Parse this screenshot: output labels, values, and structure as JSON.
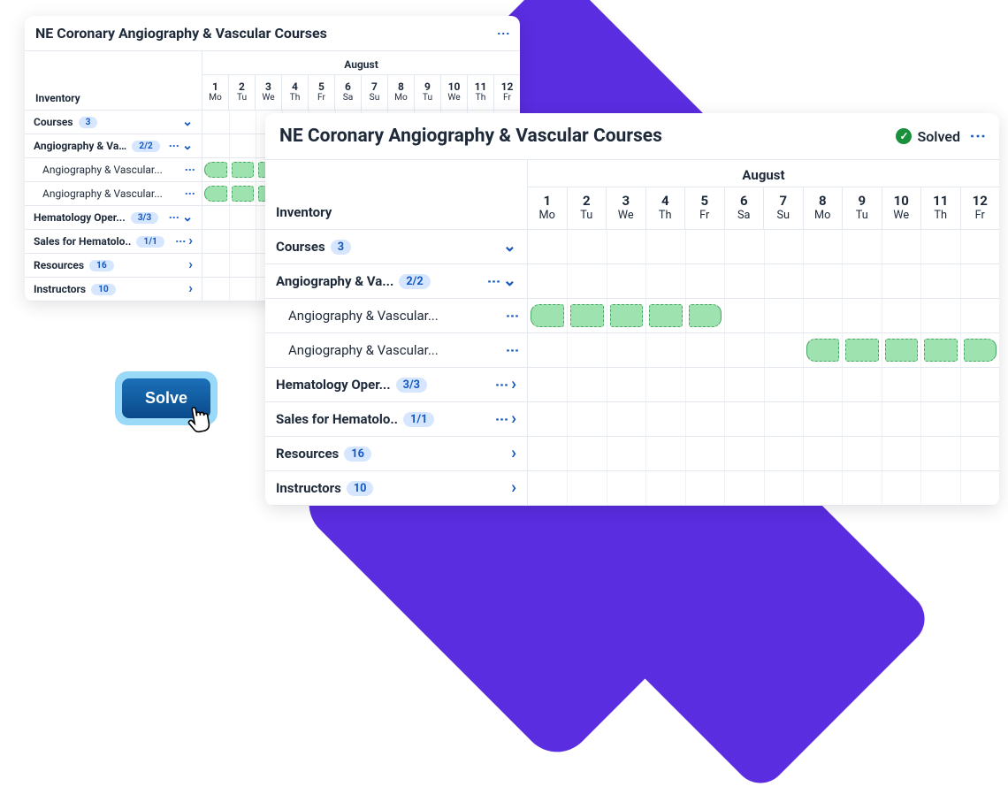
{
  "app_title": "NE Coronary Angiography & Vascular Courses",
  "solved_label": "Solved",
  "solve_button_label": "Solve",
  "month_label": "August",
  "inventory_label": "Inventory",
  "days": [
    {
      "num": "1",
      "dow": "Mo"
    },
    {
      "num": "2",
      "dow": "Tu"
    },
    {
      "num": "3",
      "dow": "We"
    },
    {
      "num": "4",
      "dow": "Th"
    },
    {
      "num": "5",
      "dow": "Fr"
    },
    {
      "num": "6",
      "dow": "Sa"
    },
    {
      "num": "7",
      "dow": "Su"
    },
    {
      "num": "8",
      "dow": "Mo"
    },
    {
      "num": "9",
      "dow": "Tu"
    },
    {
      "num": "10",
      "dow": "We"
    },
    {
      "num": "11",
      "dow": "Th"
    },
    {
      "num": "12",
      "dow": "Fr"
    }
  ],
  "rows": [
    {
      "label": "Courses",
      "badge": "3",
      "type": "group",
      "expand": "down"
    },
    {
      "label": "Angiography & Va...",
      "badge": "2/2",
      "type": "group",
      "kebab": true,
      "expand": "down"
    },
    {
      "label": "Angiography & Vascular...",
      "type": "child",
      "kebab": true,
      "blocks": [
        {
          "start": 0,
          "end": 4
        }
      ]
    },
    {
      "label": "Angiography & Vascular...",
      "type": "child",
      "kebab": true,
      "blocks": [
        {
          "start": 7,
          "end": 11
        }
      ]
    },
    {
      "label": "Hematology Oper...",
      "badge": "3/3",
      "type": "group",
      "kebab": true,
      "expand": "right"
    },
    {
      "label": "Sales for Hematolo..",
      "badge": "1/1",
      "type": "group",
      "kebab": true,
      "expand": "right"
    },
    {
      "label": "Resources",
      "badge": "16",
      "type": "group",
      "expand": "right"
    },
    {
      "label": "Instructors",
      "badge": "10",
      "type": "group",
      "expand": "right"
    }
  ],
  "rows_small": [
    {
      "label": "Courses",
      "badge": "3",
      "type": "group",
      "expand": "down"
    },
    {
      "label": "Angiography & Va...",
      "badge": "2/2",
      "type": "group",
      "kebab": true,
      "expand": "down"
    },
    {
      "label": "Angiography & Vascular...",
      "type": "child",
      "kebab": true,
      "blocks": [
        {
          "start": 0,
          "end": 2
        }
      ]
    },
    {
      "label": "Angiography & Vascular...",
      "type": "child",
      "kebab": true,
      "blocks": [
        {
          "start": 0,
          "end": 2
        }
      ]
    },
    {
      "label": "Hematology Oper...",
      "badge": "3/3",
      "type": "group",
      "kebab": true,
      "expand": "down"
    },
    {
      "label": "Sales for Hematolo..",
      "badge": "1/1",
      "type": "group",
      "kebab": true,
      "expand": "right"
    },
    {
      "label": "Resources",
      "badge": "16",
      "type": "group",
      "expand": "right"
    },
    {
      "label": "Instructors",
      "badge": "10",
      "type": "group",
      "expand": "right"
    }
  ]
}
